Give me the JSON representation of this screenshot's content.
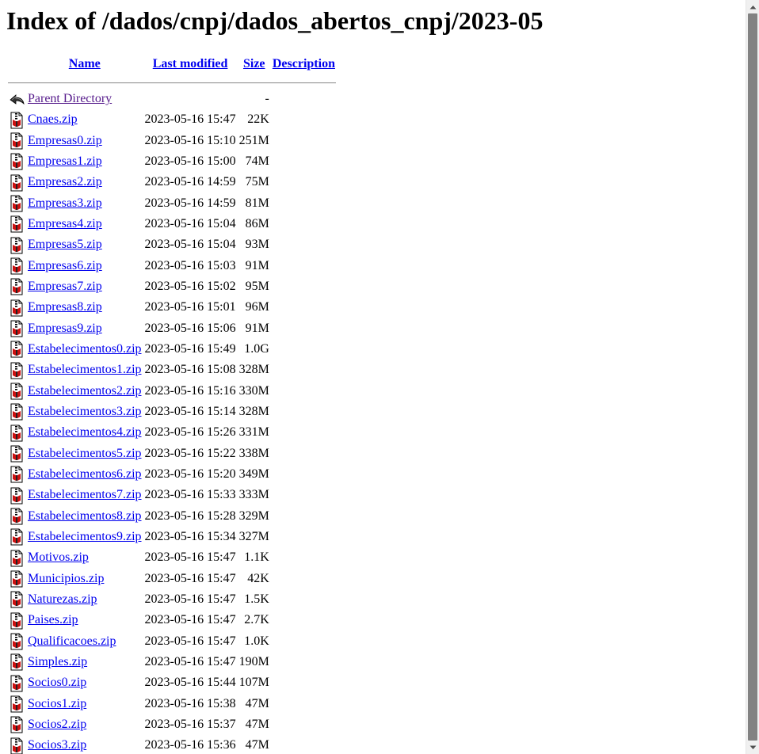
{
  "page": {
    "title": "Index of /dados/cnpj/dados_abertos_cnpj/2023-05"
  },
  "table": {
    "headers": {
      "name": "Name",
      "last_modified": "Last modified",
      "size": "Size",
      "description": "Description"
    },
    "parent": {
      "label": "Parent Directory",
      "size": "-",
      "icon": "back-arrow-icon"
    },
    "rows": [
      {
        "name": "Cnaes.zip",
        "date": "2023-05-16 15:47",
        "size": "22K",
        "icon": "compressed-file-icon"
      },
      {
        "name": "Empresas0.zip",
        "date": "2023-05-16 15:10",
        "size": "251M",
        "icon": "compressed-file-icon"
      },
      {
        "name": "Empresas1.zip",
        "date": "2023-05-16 15:00",
        "size": "74M",
        "icon": "compressed-file-icon"
      },
      {
        "name": "Empresas2.zip",
        "date": "2023-05-16 14:59",
        "size": "75M",
        "icon": "compressed-file-icon"
      },
      {
        "name": "Empresas3.zip",
        "date": "2023-05-16 14:59",
        "size": "81M",
        "icon": "compressed-file-icon"
      },
      {
        "name": "Empresas4.zip",
        "date": "2023-05-16 15:04",
        "size": "86M",
        "icon": "compressed-file-icon"
      },
      {
        "name": "Empresas5.zip",
        "date": "2023-05-16 15:04",
        "size": "93M",
        "icon": "compressed-file-icon"
      },
      {
        "name": "Empresas6.zip",
        "date": "2023-05-16 15:03",
        "size": "91M",
        "icon": "compressed-file-icon"
      },
      {
        "name": "Empresas7.zip",
        "date": "2023-05-16 15:02",
        "size": "95M",
        "icon": "compressed-file-icon"
      },
      {
        "name": "Empresas8.zip",
        "date": "2023-05-16 15:01",
        "size": "96M",
        "icon": "compressed-file-icon"
      },
      {
        "name": "Empresas9.zip",
        "date": "2023-05-16 15:06",
        "size": "91M",
        "icon": "compressed-file-icon"
      },
      {
        "name": "Estabelecimentos0.zip",
        "date": "2023-05-16 15:49",
        "size": "1.0G",
        "icon": "compressed-file-icon"
      },
      {
        "name": "Estabelecimentos1.zip",
        "date": "2023-05-16 15:08",
        "size": "328M",
        "icon": "compressed-file-icon"
      },
      {
        "name": "Estabelecimentos2.zip",
        "date": "2023-05-16 15:16",
        "size": "330M",
        "icon": "compressed-file-icon"
      },
      {
        "name": "Estabelecimentos3.zip",
        "date": "2023-05-16 15:14",
        "size": "328M",
        "icon": "compressed-file-icon"
      },
      {
        "name": "Estabelecimentos4.zip",
        "date": "2023-05-16 15:26",
        "size": "331M",
        "icon": "compressed-file-icon"
      },
      {
        "name": "Estabelecimentos5.zip",
        "date": "2023-05-16 15:22",
        "size": "338M",
        "icon": "compressed-file-icon"
      },
      {
        "name": "Estabelecimentos6.zip",
        "date": "2023-05-16 15:20",
        "size": "349M",
        "icon": "compressed-file-icon"
      },
      {
        "name": "Estabelecimentos7.zip",
        "date": "2023-05-16 15:33",
        "size": "333M",
        "icon": "compressed-file-icon"
      },
      {
        "name": "Estabelecimentos8.zip",
        "date": "2023-05-16 15:28",
        "size": "329M",
        "icon": "compressed-file-icon"
      },
      {
        "name": "Estabelecimentos9.zip",
        "date": "2023-05-16 15:34",
        "size": "327M",
        "icon": "compressed-file-icon"
      },
      {
        "name": "Motivos.zip",
        "date": "2023-05-16 15:47",
        "size": "1.1K",
        "icon": "compressed-file-icon"
      },
      {
        "name": "Municipios.zip",
        "date": "2023-05-16 15:47",
        "size": "42K",
        "icon": "compressed-file-icon"
      },
      {
        "name": "Naturezas.zip",
        "date": "2023-05-16 15:47",
        "size": "1.5K",
        "icon": "compressed-file-icon"
      },
      {
        "name": "Paises.zip",
        "date": "2023-05-16 15:47",
        "size": "2.7K",
        "icon": "compressed-file-icon"
      },
      {
        "name": "Qualificacoes.zip",
        "date": "2023-05-16 15:47",
        "size": "1.0K",
        "icon": "compressed-file-icon"
      },
      {
        "name": "Simples.zip",
        "date": "2023-05-16 15:47",
        "size": "190M",
        "icon": "compressed-file-icon"
      },
      {
        "name": "Socios0.zip",
        "date": "2023-05-16 15:44",
        "size": "107M",
        "icon": "compressed-file-icon"
      },
      {
        "name": "Socios1.zip",
        "date": "2023-05-16 15:38",
        "size": "47M",
        "icon": "compressed-file-icon"
      },
      {
        "name": "Socios2.zip",
        "date": "2023-05-16 15:37",
        "size": "47M",
        "icon": "compressed-file-icon"
      },
      {
        "name": "Socios3.zip",
        "date": "2023-05-16 15:36",
        "size": "47M",
        "icon": "compressed-file-icon"
      }
    ]
  },
  "colors": {
    "link": "#0000ee",
    "visited_link": "#551a8b",
    "scrollbar_track": "#f0f0f0",
    "scrollbar_thumb": "#828282"
  }
}
